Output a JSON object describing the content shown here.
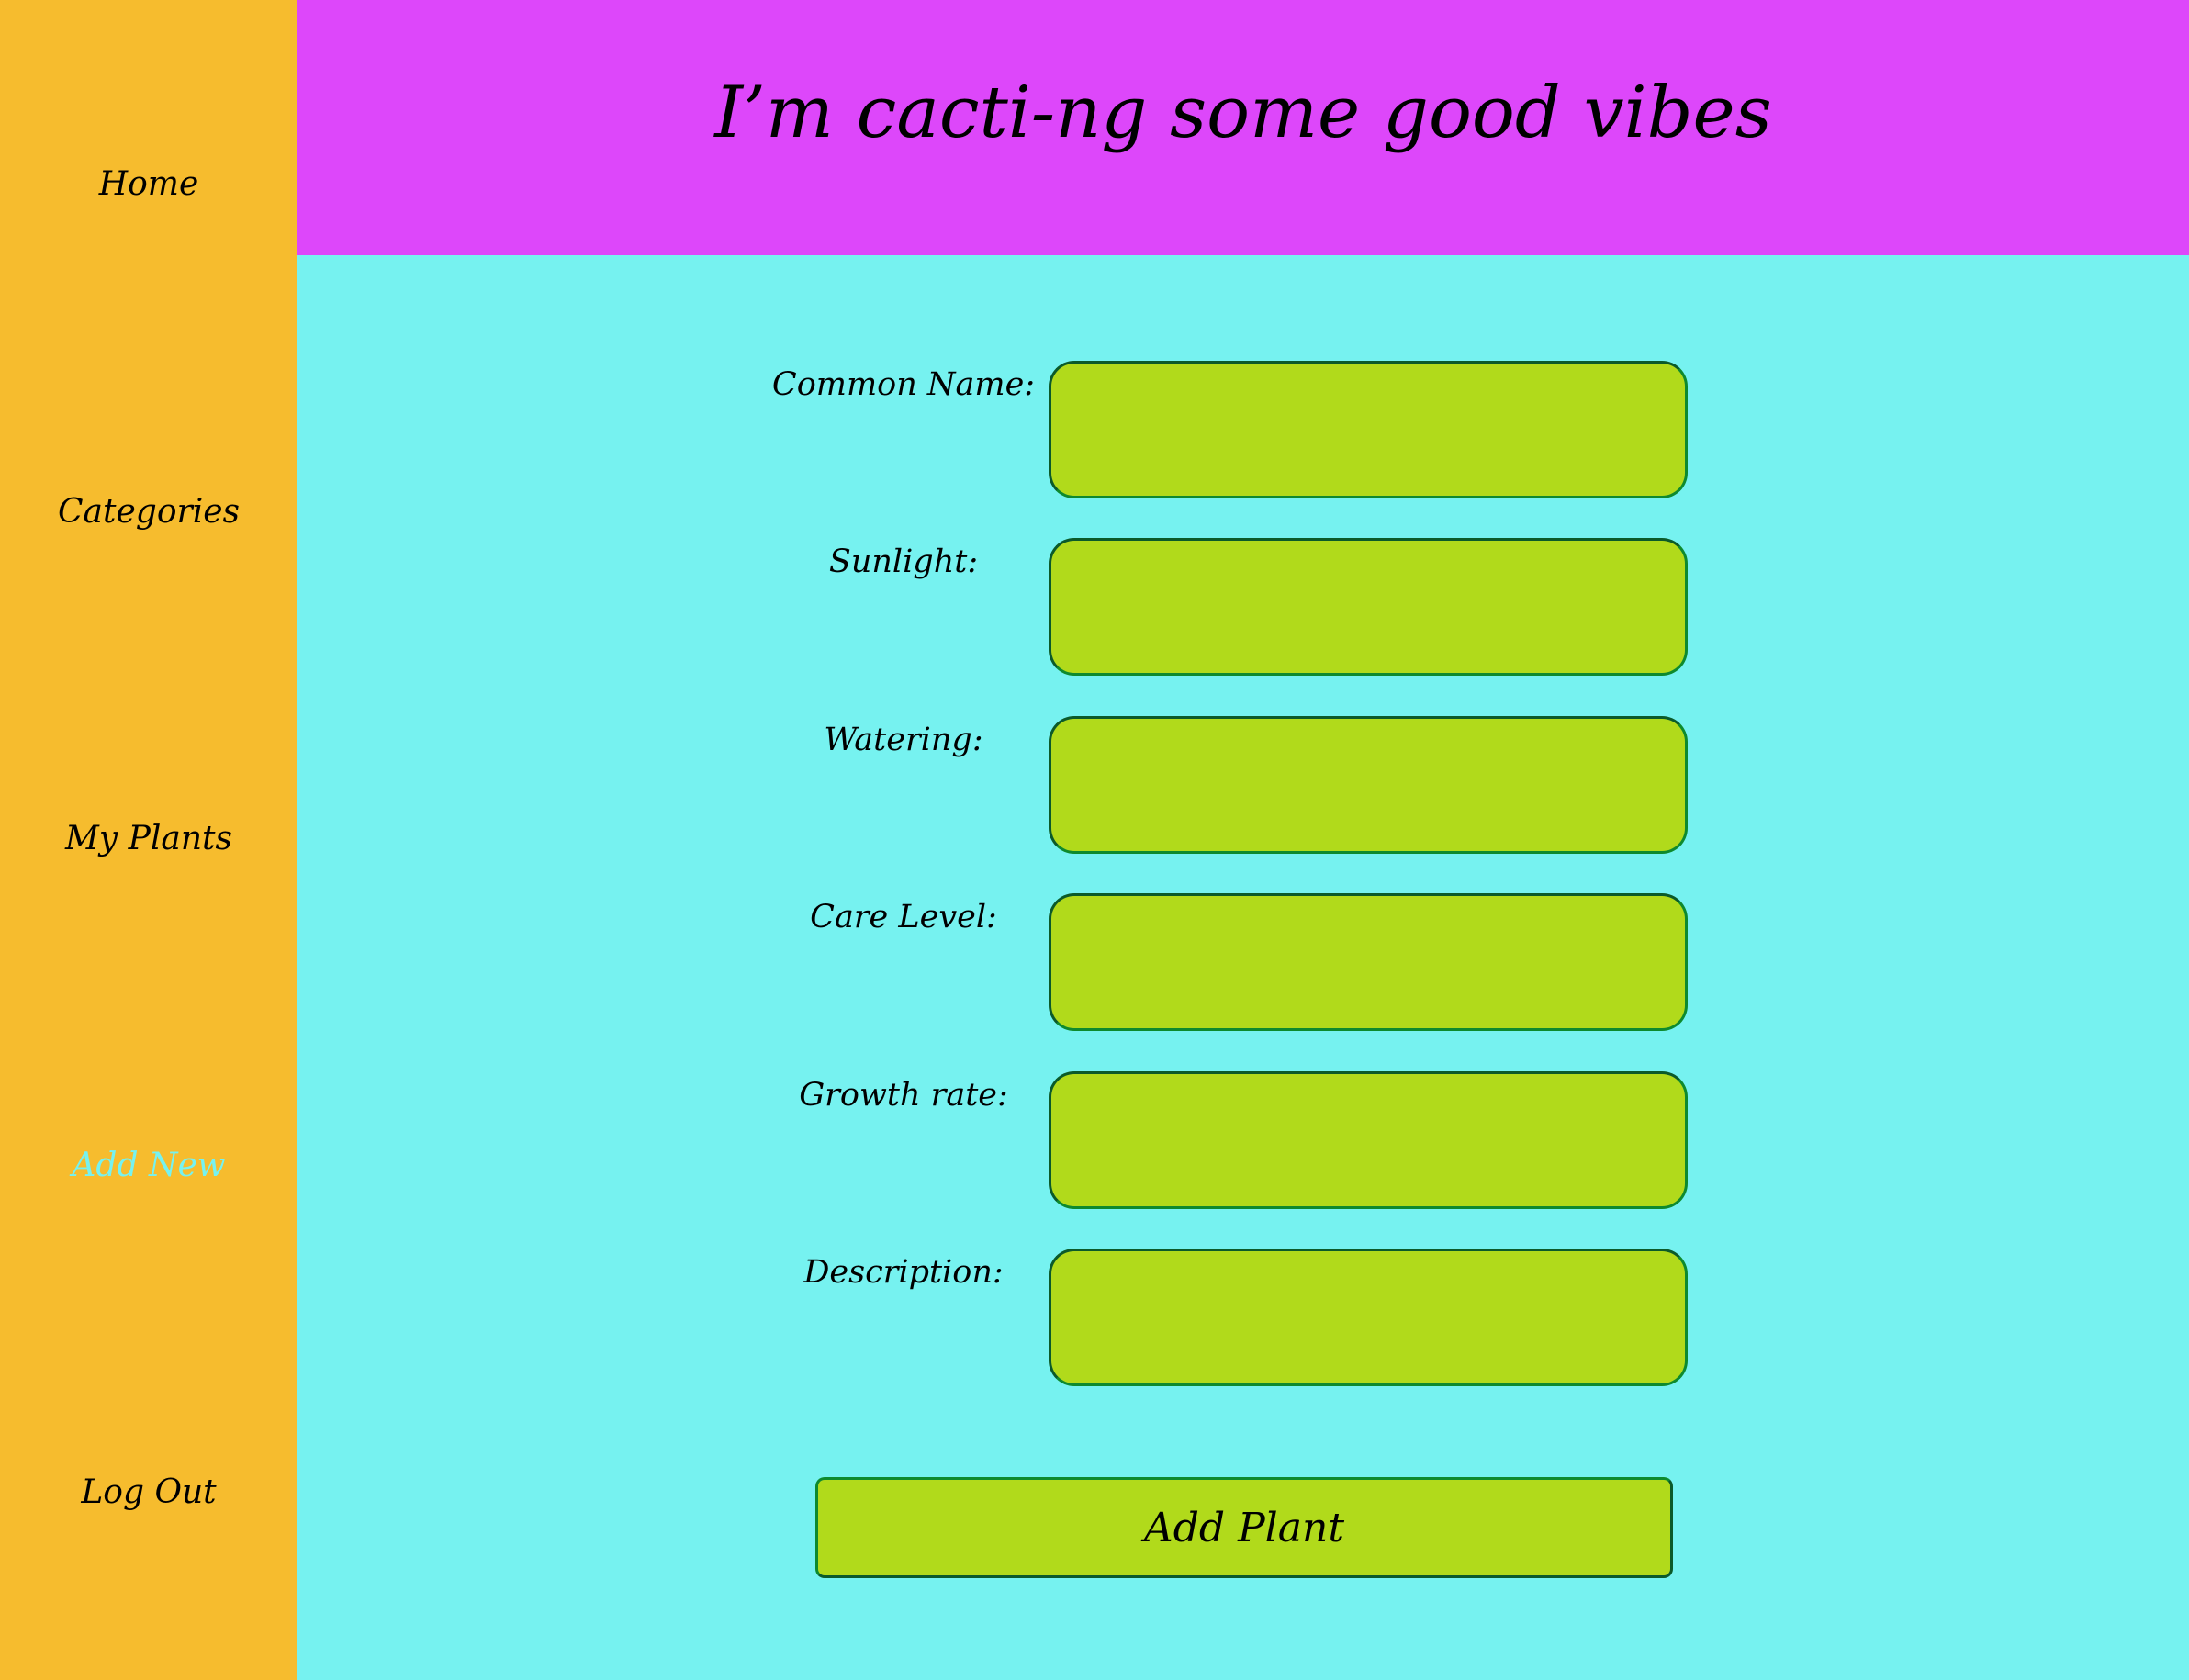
{
  "sidebar": {
    "items": [
      {
        "label": "Home"
      },
      {
        "label": "Categories"
      },
      {
        "label": "My Plants"
      },
      {
        "label": "Add New",
        "active": true
      },
      {
        "label": "Log Out"
      }
    ]
  },
  "header": {
    "title": "I’m cacti-ng some good vibes"
  },
  "form": {
    "fields": [
      {
        "label": "Common Name:",
        "value": ""
      },
      {
        "label": "Sunlight:",
        "value": ""
      },
      {
        "label": "Watering:",
        "value": ""
      },
      {
        "label": "Care Level:",
        "value": ""
      },
      {
        "label": "Growth rate:",
        "value": ""
      },
      {
        "label": "Description:",
        "value": ""
      }
    ],
    "submit_label": "Add Plant"
  },
  "colors": {
    "sidebar_bg": "#F6BC2E",
    "header_bg": "#DD47FA",
    "main_bg": "#76F2F0",
    "input_bg": "#B1DA1B",
    "input_border": "#0E8A2E",
    "active_nav_text": "#76F2F0"
  }
}
